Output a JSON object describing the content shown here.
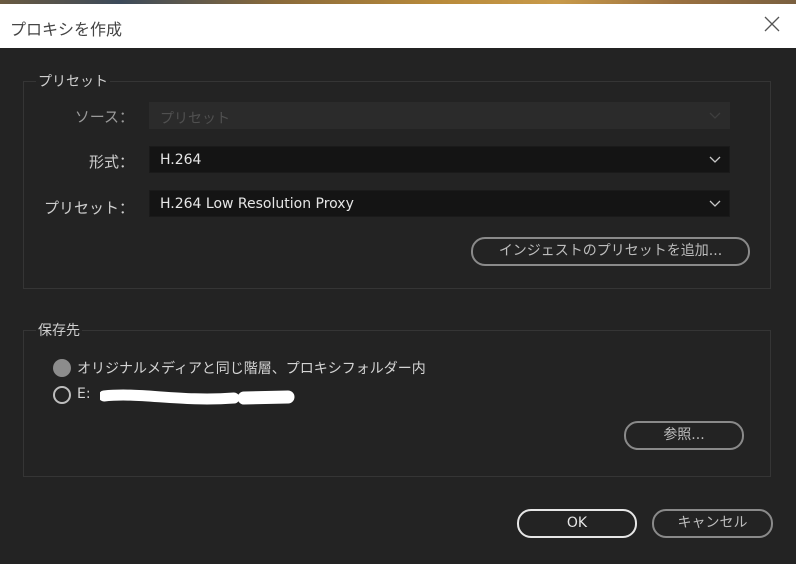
{
  "dialog": {
    "title": "プロキシを作成"
  },
  "preset_group": {
    "legend": "プリセット",
    "source": {
      "label": "ソース：",
      "value": "プリセット",
      "enabled": false
    },
    "format": {
      "label": "形式：",
      "value": "H.264"
    },
    "preset": {
      "label": "プリセット：",
      "value": "H.264 Low Resolution Proxy"
    },
    "add_ingest_preset_label": "インジェストのプリセットを追加..."
  },
  "destination_group": {
    "legend": "保存先",
    "options": [
      {
        "label": "オリジナルメディアと同じ階層、プロキシフォルダー内",
        "selected": true
      },
      {
        "label": "E:",
        "selected": false
      }
    ],
    "browse_label": "参照..."
  },
  "footer": {
    "ok_label": "OK",
    "cancel_label": "キャンセル"
  },
  "icons": {
    "close": "close-icon",
    "dropdown": "chevron-down-icon"
  }
}
